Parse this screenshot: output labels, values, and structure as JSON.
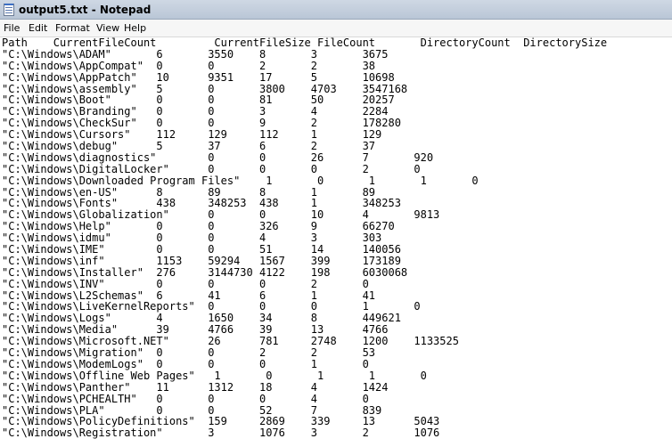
{
  "window": {
    "title": "output5.txt - Notepad"
  },
  "menu": [
    "File",
    "Edit",
    "Format",
    "View",
    "Help"
  ],
  "lines": [
    "Path    CurrentFileCount         CurrentFileSize FileCount       DirectoryCount  DirectorySize",
    "\"C:\\Windows\\ADAM\"       6       3550    8       3       3675",
    "\"C:\\Windows\\AppCompat\"  0       0       2       2       38",
    "\"C:\\Windows\\AppPatch\"   10      9351    17      5       10698",
    "\"C:\\Windows\\assembly\"   5       0       3800    4703    3547168",
    "\"C:\\Windows\\Boot\"       0       0       81      50      20257",
    "\"C:\\Windows\\Branding\"   0       0       3       4       2284",
    "\"C:\\Windows\\CheckSur\"   0       0       9       2       178280",
    "\"C:\\Windows\\Cursors\"    112     129     112     1       129",
    "\"C:\\Windows\\debug\"      5       37      6       2       37",
    "\"C:\\Windows\\diagnostics\"        0       0       26      7       920",
    "\"C:\\Windows\\DigitalLocker\"      0       0       0       2       0",
    "\"C:\\Windows\\Downloaded Program Files\"    1       0       1       1       0",
    "\"C:\\Windows\\en-US\"      8       89      8       1       89",
    "\"C:\\Windows\\Fonts\"      438     348253  438     1       348253",
    "\"C:\\Windows\\Globalization\"      0       0       10      4       9813",
    "\"C:\\Windows\\Help\"       0       0       326     9       66270",
    "\"C:\\Windows\\idmu\"       0       0       4       3       303",
    "\"C:\\Windows\\IME\"        0       0       51      14      140056",
    "\"C:\\Windows\\inf\"        1153    59294   1567    399     173189",
    "\"C:\\Windows\\Installer\"  276     3144730 4122    198     6030068",
    "\"C:\\Windows\\INV\"        0       0       0       2       0",
    "\"C:\\Windows\\L2Schemas\"  6       41      6       1       41",
    "\"C:\\Windows\\LiveKernelReports\"  0       0       0       1       0",
    "\"C:\\Windows\\Logs\"       4       1650    34      8       449621",
    "\"C:\\Windows\\Media\"      39      4766    39      13      4766",
    "\"C:\\Windows\\Microsoft.NET\"      26      781     2748    1200    1133525",
    "\"C:\\Windows\\Migration\"  0       0       2       2       53",
    "\"C:\\Windows\\ModemLogs\"  0       0       0       1       0",
    "\"C:\\Windows\\Offline Web Pages\"   1       0       1       1       0",
    "\"C:\\Windows\\Panther\"    11      1312    18      4       1424",
    "\"C:\\Windows\\PCHEALTH\"   0       0       0       4       0",
    "\"C:\\Windows\\PLA\"        0       0       52      7       839",
    "\"C:\\Windows\\PolicyDefinitions\"  159     2869    339     13      5043",
    "\"C:\\Windows\\Registration\"       3       1076    3       2       1076"
  ]
}
